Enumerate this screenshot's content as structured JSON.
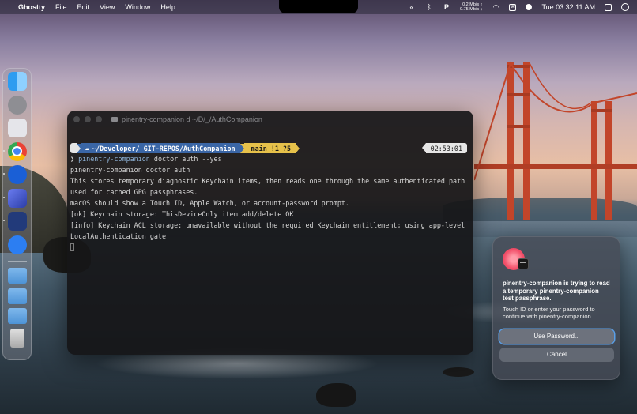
{
  "menubar": {
    "apple": "",
    "app_name": "Ghostty",
    "menus": [
      "File",
      "Edit",
      "View",
      "Window",
      "Help"
    ],
    "net_up": "0.2 Mb/s ↑",
    "net_down": "0.75 Mb/s ↓",
    "clock": "Tue 03:32:11 AM",
    "status_glyphs": {
      "rewind": "«",
      "bluetooth": "ᛒ",
      "p_app": "P",
      "wifi": "◠",
      "box": "⌘"
    }
  },
  "dock": {
    "items": [
      "finder",
      "system-settings",
      "launchpad",
      "chrome",
      "app5",
      "app6",
      "app7",
      "app8"
    ],
    "folders": [
      "applications-folder",
      "developer-folder",
      "downloads-folder"
    ],
    "trash": "trash"
  },
  "terminal": {
    "window_title": "pinentry-companion d ~/D/_/AuthCompanion",
    "prompt": {
      "apple": "",
      "path": "~/Developer/_GIT-REPOS/AuthCompanion",
      "git_icon": "",
      "git_status": "main !1 ?5",
      "time": "02:53:01"
    },
    "command_arrow": "❯",
    "command_name": "pinentry-companion",
    "command_args": " doctor auth --yes",
    "lines": [
      "pinentry-companion doctor auth",
      "",
      "This stores temporary diagnostic Keychain items, then reads one through the same authenticated path",
      "used for cached GPG passphrases.",
      "macOS should show a Touch ID, Apple Watch, or account-password prompt.",
      "[ok] Keychain storage: ThisDeviceOnly item add/delete OK",
      "[info] Keychain ACL storage: unavailable without the required Keychain entitlement; using app-level",
      "LocalAuthentication gate"
    ]
  },
  "dialog": {
    "title": "pinentry-companion is trying to read a temporary pinentry-companion test passphrase.",
    "message": "Touch ID or enter your password to continue with pinentry-companion.",
    "primary_button": "Use Password...",
    "secondary_button": "Cancel"
  }
}
